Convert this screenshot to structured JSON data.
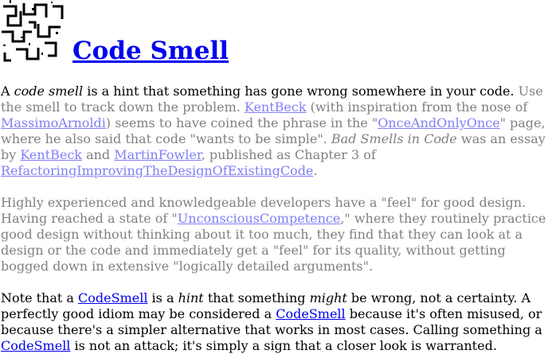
{
  "page": {
    "title": "Code Smell",
    "logo": "wiki-maze-logo"
  },
  "p1": {
    "s1_a": "A ",
    "s1_em": "code smell",
    "s1_b": " is a hint that something has gone wrong somewhere in your code.",
    "f1": " Use the smell to track down the problem. ",
    "link_kentbeck_1": "KentBeck",
    "f2": " (with inspiration from the nose of ",
    "link_massimo": "MassimoArnoldi",
    "f3": ") seems to have coined the phrase in the \"",
    "link_onceandonlyonce": "OnceAndOnlyOnce",
    "f4": "\" page, where he also said that code \"wants to be simple\". ",
    "f4_em": "Bad Smells in Code",
    "f5": " was an essay by ",
    "link_kentbeck_2": "KentBeck",
    "f6": " and ",
    "link_martinfowler": "MartinFowler",
    "f7": ", published as Chapter 3 of ",
    "link_refactoring": "RefactoringImprovingTheDesignOfExistingCode",
    "f8": "."
  },
  "p2": {
    "a": "Highly experienced and knowledgeable developers have a \"feel\" for good design. Having reached a state of \"",
    "link_unconscious": "UnconsciousCompetence",
    "b": ",\" where they routinely practice good design without thinking about it too much, they find that they can look at a design or the code and immediately get a \"feel\" for its quality, without getting bogged down in extensive \"logically detailed arguments\"."
  },
  "p3": {
    "a": "Note that a ",
    "link_codesmell_1": "CodeSmell",
    "b": " is a ",
    "em1": "hint",
    "c": " that something ",
    "em2": "might",
    "d": " be wrong, not a certainty. A perfectly good idiom may be considered a ",
    "link_codesmell_2": "CodeSmell",
    "e": " because it's often misused, or because there's a simpler alternative that works in most cases. Calling something a ",
    "link_codesmell_3": "CodeSmell",
    "f": " is not an attack; it's simply a sign that a closer look is warranted."
  },
  "colors": {
    "link": "#0000ee",
    "faded_link": "#7f7ff6",
    "faded_text": "#808080",
    "text": "#000000",
    "background": "#ffffff"
  }
}
